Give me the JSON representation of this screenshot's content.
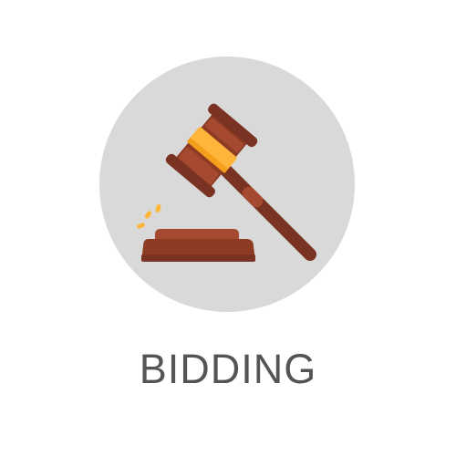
{
  "icon": {
    "name": "gavel-icon",
    "circle_color": "#d9d9d9",
    "handle_color": "#7a3323",
    "head_color": "#8e3b24",
    "band_color": "#ffb53a",
    "block_color": "#8e3b24",
    "sparkle_color": "#ffb53a"
  },
  "label": {
    "text": "BIDDING"
  }
}
